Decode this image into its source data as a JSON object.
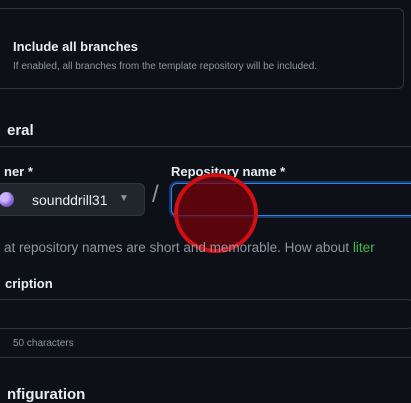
{
  "template_option": {
    "title": "Include all branches",
    "description": "If enabled, all branches from the template repository will be included."
  },
  "general": {
    "title": "eral",
    "owner": {
      "label": "ner *",
      "selected": "sounddrill31"
    },
    "repository_name": {
      "label": "Repository name *",
      "value": ""
    },
    "hint": {
      "text": "at repository names are short and memorable. How about ",
      "suggestion": "liter"
    }
  },
  "description": {
    "label": "cription",
    "value": "",
    "char_limit_text": "50 characters"
  },
  "configuration": {
    "title": "nfiguration"
  },
  "colors": {
    "background": "#0d1117",
    "border": "#30363d",
    "focus": "#2f81f7",
    "muted_text": "#8d96a0",
    "suggestion": "#3fb950",
    "highlight": "#d10f15"
  },
  "icons": {
    "owner_avatar": "avatar-icon",
    "owner_dropdown": "caret-down-icon"
  },
  "separator": "/"
}
